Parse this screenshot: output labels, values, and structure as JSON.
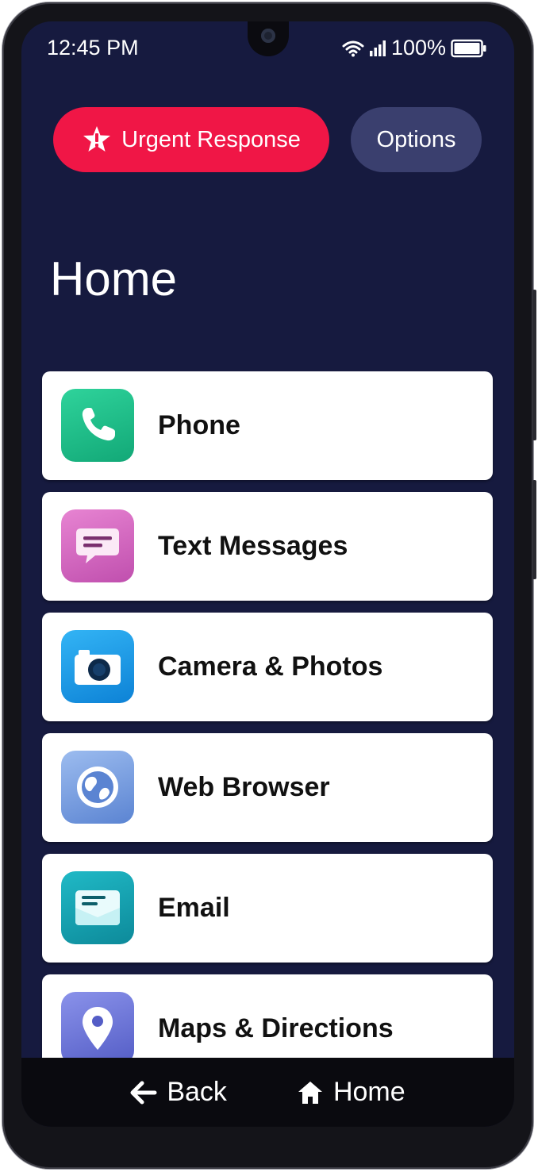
{
  "status_bar": {
    "time": "12:45 PM",
    "battery": "100%",
    "icons": [
      "wifi-icon",
      "signal-icon",
      "battery-icon"
    ]
  },
  "header": {
    "urgent_label": "Urgent Response",
    "options_label": "Options",
    "title": "Home"
  },
  "apps": [
    {
      "label": "Phone",
      "icon": "phone-icon",
      "color": "#1fbf8a"
    },
    {
      "label": "Text Messages",
      "icon": "message-icon",
      "color": "#d86ac4"
    },
    {
      "label": "Camera & Photos",
      "icon": "camera-icon",
      "color": "#1e9de8"
    },
    {
      "label": "Web Browser",
      "icon": "globe-icon",
      "color": "#6f9ae0"
    },
    {
      "label": "Email",
      "icon": "email-icon",
      "color": "#1aa3b3"
    },
    {
      "label": "Maps & Directions",
      "icon": "map-pin-icon",
      "color": "#6b74d8"
    }
  ],
  "nav": {
    "back_label": "Back",
    "home_label": "Home"
  },
  "colors": {
    "background": "#161a3f",
    "urgent": "#f01646",
    "options": "#3a3f6e"
  }
}
